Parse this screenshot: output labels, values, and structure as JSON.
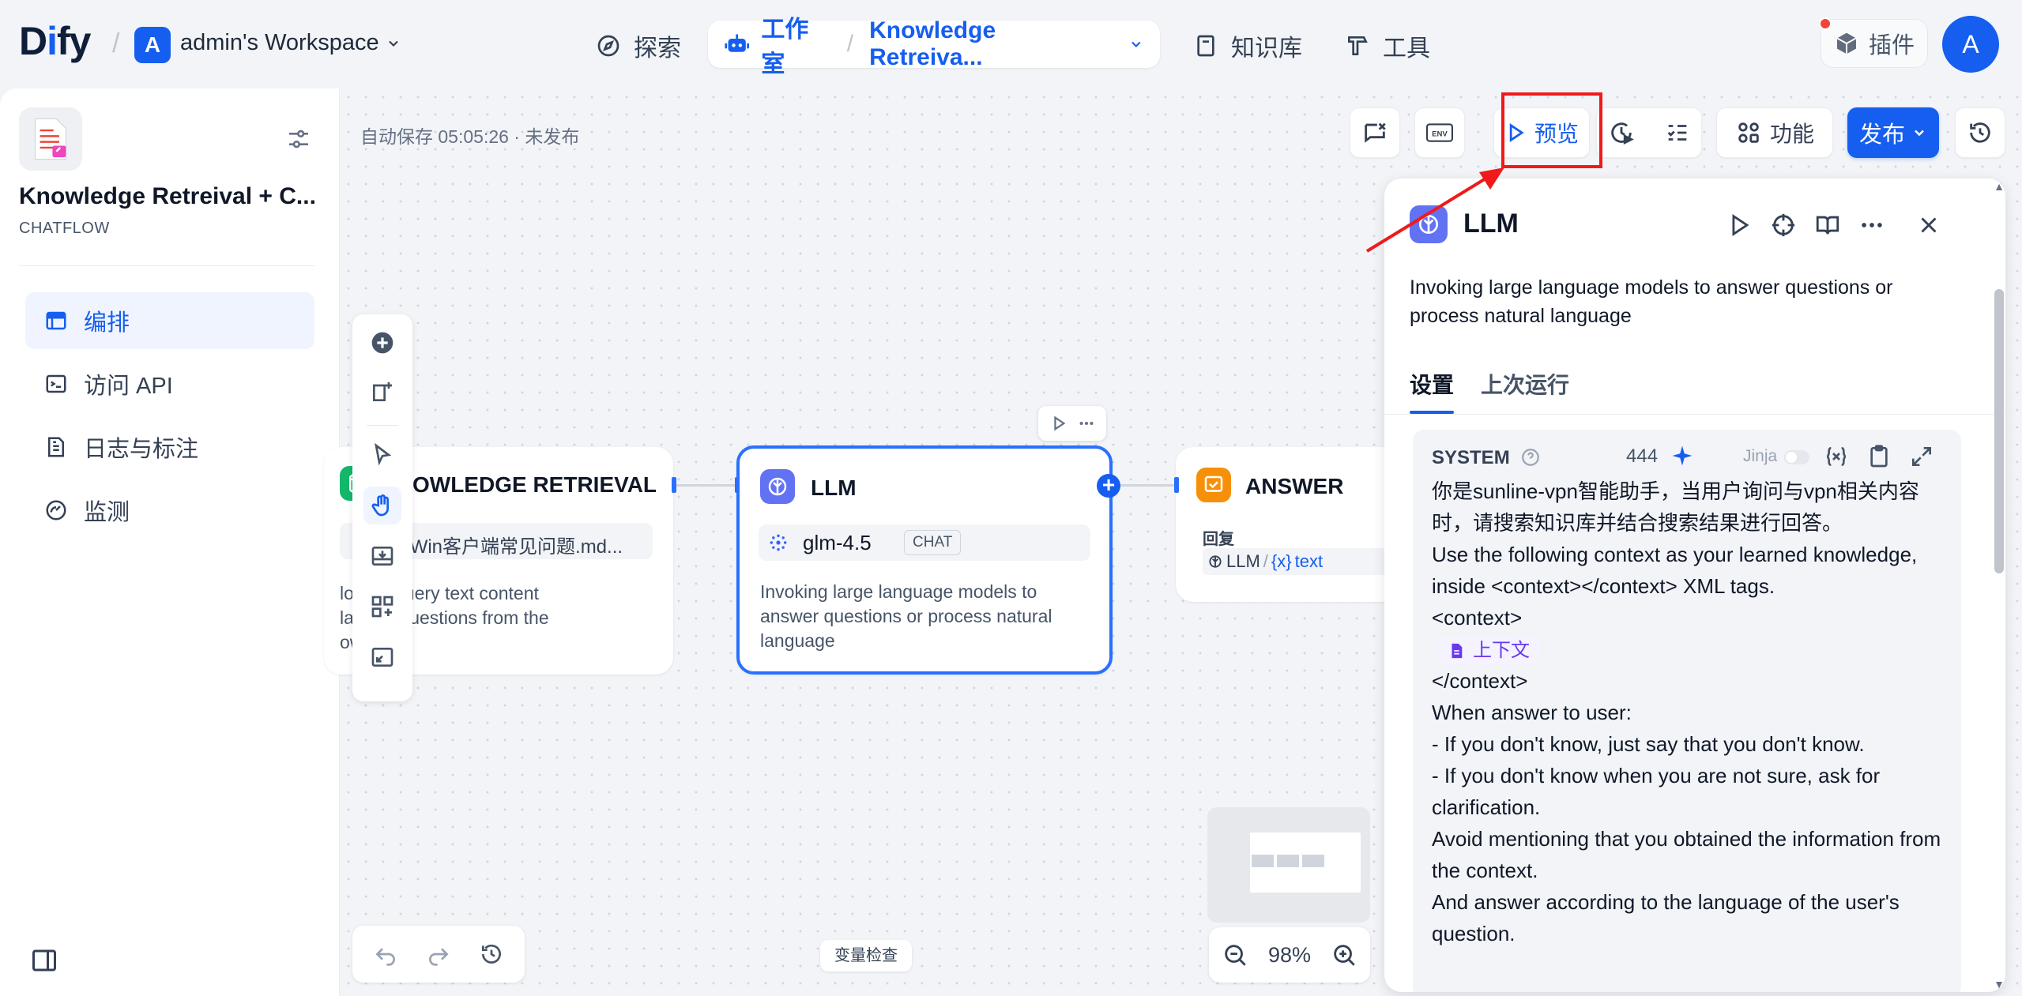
{
  "brand": {
    "logo_prefix": "D",
    "logo_i": "i",
    "logo_suffix": "fy"
  },
  "workspace": {
    "avatar": "A",
    "name": "admin's Workspace"
  },
  "nav": {
    "explore": "探索",
    "studio": "工作室",
    "current_app": "Knowledge Retreiva...",
    "knowledge": "知识库",
    "tools": "工具",
    "plugins": "插件"
  },
  "user": {
    "avatar": "A"
  },
  "sidebar": {
    "app_name": "Knowledge Retreival + C...",
    "app_mode": "CHATFLOW",
    "items": [
      {
        "label": "编排",
        "icon": "layout-icon",
        "active": true
      },
      {
        "label": "访问 API",
        "icon": "terminal-icon",
        "active": false
      },
      {
        "label": "日志与标注",
        "icon": "document-icon",
        "active": false
      },
      {
        "label": "监测",
        "icon": "gauge-icon",
        "active": false
      }
    ]
  },
  "canvas": {
    "autosave": "自动保存 05:05:26 · 未发布",
    "toolbar": {
      "preview": "预览",
      "features": "功能",
      "publish": "发布",
      "env": "ENV"
    },
    "var_inspect": "变量检查",
    "zoom": "98%",
    "nodes": {
      "kr": {
        "title": "KNOWLEDGE RETRIEVAL",
        "title_visible": "OWLEDGE RETRIEVAL",
        "dataset": "VPN_Win客户端常见问题.md...",
        "desc_line1": "lo     u to query text content",
        "desc_line2": "la     user questions from the",
        "desc_line3": "owledge"
      },
      "llm": {
        "title": "LLM",
        "model": "glm-4.5",
        "model_badge": "CHAT",
        "desc": "Invoking large language models to answer questions or process natural language"
      },
      "answer": {
        "title": "ANSWER",
        "reply_label": "回复",
        "var_node": "LLM",
        "var_sep": "/",
        "var_braces": "{x}",
        "var_name": "text"
      }
    }
  },
  "panel": {
    "title": "LLM",
    "description": "Invoking large language models to answer questions or process natural language",
    "tabs": [
      "设置",
      "上次运行"
    ],
    "prompt": {
      "role": "SYSTEM",
      "tokens": "444",
      "jinja": "Jinja",
      "line1": "你是sunline-vpn智能助手，当用户询问与vpn相关内容时，请搜索知识库并结合搜索结果进行回答。",
      "line2": "Use the following context as your learned knowledge, inside <context></context> XML tags.",
      "line3": "<context>",
      "context_chip": "上下文",
      "line4": "</context>",
      "line5": "When answer to user:",
      "line6": "- If you don't know, just say that you don't know.",
      "line7": "- If you don't know when you are not sure, ask for clarification.",
      "line8": "Avoid mentioning that you obtained the information from the context.",
      "line9": "And answer according to the language of the user's question."
    }
  },
  "colors": {
    "accent": "#155eef",
    "kr_node": "#12b76a",
    "llm_node": "#6172f3",
    "answer_node": "#f79009",
    "annotation": "#f01a1a"
  }
}
